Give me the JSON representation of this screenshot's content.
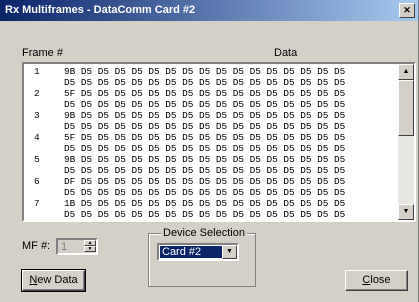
{
  "window": {
    "title": "Rx Multiframes - DataComm Card #2"
  },
  "headers": {
    "frame": "Frame #",
    "data": "Data"
  },
  "rows": [
    {
      "frame": "1",
      "bytes": "9B D5 D5 D5 D5 D5 D5 D5 D5 D5 D5 D5 D5 D5 D5 D5 D5"
    },
    {
      "frame": "",
      "bytes": "D5 D5 D5 D5 D5 D5 D5 D5 D5 D5 D5 D5 D5 D5 D5 D5 D5"
    },
    {
      "frame": "2",
      "bytes": "5F D5 D5 D5 D5 D5 D5 D5 D5 D5 D5 D5 D5 D5 D5 D5 D5"
    },
    {
      "frame": "",
      "bytes": "D5 D5 D5 D5 D5 D5 D5 D5 D5 D5 D5 D5 D5 D5 D5 D5 D5"
    },
    {
      "frame": "3",
      "bytes": "9B D5 D5 D5 D5 D5 D5 D5 D5 D5 D5 D5 D5 D5 D5 D5 D5"
    },
    {
      "frame": "",
      "bytes": "D5 D5 D5 D5 D5 D5 D5 D5 D5 D5 D5 D5 D5 D5 D5 D5 D5"
    },
    {
      "frame": "4",
      "bytes": "5F D5 D5 D5 D5 D5 D5 D5 D5 D5 D5 D5 D5 D5 D5 D5 D5"
    },
    {
      "frame": "",
      "bytes": "D5 D5 D5 D5 D5 D5 D5 D5 D5 D5 D5 D5 D5 D5 D5 D5 D5"
    },
    {
      "frame": "5",
      "bytes": "9B D5 D5 D5 D5 D5 D5 D5 D5 D5 D5 D5 D5 D5 D5 D5 D5"
    },
    {
      "frame": "",
      "bytes": "D5 D5 D5 D5 D5 D5 D5 D5 D5 D5 D5 D5 D5 D5 D5 D5 D5"
    },
    {
      "frame": "6",
      "bytes": "DF D5 D5 D5 D5 D5 D5 D5 D5 D5 D5 D5 D5 D5 D5 D5 D5"
    },
    {
      "frame": "",
      "bytes": "D5 D5 D5 D5 D5 D5 D5 D5 D5 D5 D5 D5 D5 D5 D5 D5 D5"
    },
    {
      "frame": "7",
      "bytes": "1B D5 D5 D5 D5 D5 D5 D5 D5 D5 D5 D5 D5 D5 D5 D5 D5"
    },
    {
      "frame": "",
      "bytes": "D5 D5 D5 D5 D5 D5 D5 D5 D5 D5 D5 D5 D5 D5 D5 D5 D5"
    }
  ],
  "mf": {
    "label": "MF #:",
    "value": "1"
  },
  "device": {
    "legend": "Device Selection",
    "selected": "Card #2"
  },
  "buttons": {
    "new_data": "New Data",
    "new_data_mnemonic": "N",
    "new_data_rest": "ew Data",
    "close": "Close",
    "close_mnemonic": "C",
    "close_rest": "lose"
  }
}
